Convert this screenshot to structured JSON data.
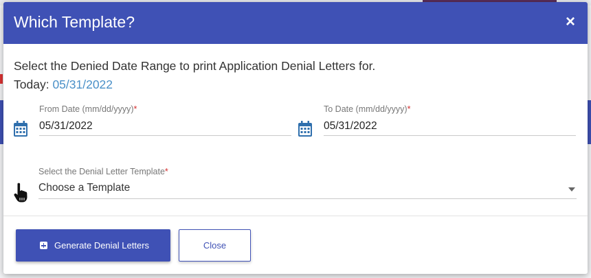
{
  "modal": {
    "title": "Which Template?",
    "close_symbol": "×",
    "intro_text": "Select the Denied Date Range to print Application Denial Letters for.",
    "today_label": "Today:",
    "today_value": "05/31/2022"
  },
  "from_date": {
    "label": "From Date (mm/dd/yyyy)",
    "required_marker": "*",
    "value": "05/31/2022",
    "icon": "calendar-icon"
  },
  "to_date": {
    "label": "To Date (mm/dd/yyyy)",
    "required_marker": "*",
    "value": "05/31/2022",
    "icon": "calendar-icon"
  },
  "template_select": {
    "label": "Select the Denial Letter Template",
    "required_marker": "*",
    "selected": "Choose a Template",
    "icon": "pointer-hand-icon"
  },
  "buttons": {
    "generate_label": "Generate Denial Letters",
    "generate_icon": "plus-square-icon",
    "close_label": "Close"
  },
  "colors": {
    "accent": "#3f51b5",
    "link_blue": "#4a90c8",
    "required_red": "#d32f2f"
  }
}
